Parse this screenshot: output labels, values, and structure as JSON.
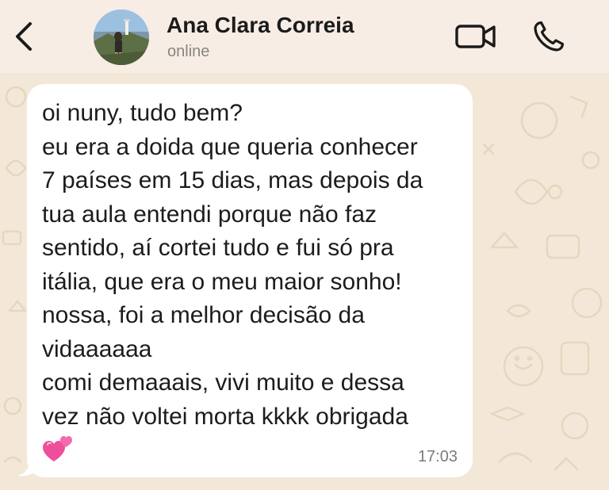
{
  "header": {
    "back_icon": "chevron-left-icon",
    "contact_name": "Ana Clara Correia",
    "contact_status": "online",
    "video_call_icon": "video-camera-icon",
    "voice_call_icon": "phone-icon"
  },
  "message": {
    "lines": [
      "oi nuny, tudo bem?",
      "eu era a doida que queria conhecer",
      "7 países em 15 dias, mas depois da",
      "tua aula entendi porque não faz",
      "sentido, aí cortei tudo e fui só pra",
      "itália, que era o meu maior sonho!",
      "nossa, foi a melhor decisão da",
      "vidaaaaaa",
      "comi demaaais, vivi muito e dessa",
      "vez não voltei morta kkkk obrigada"
    ],
    "emoji": "two-hearts-emoji",
    "time": "17:03"
  },
  "colors": {
    "header_bg": "#f7ede4",
    "chat_bg": "#f3e8d8",
    "bubble_bg": "#ffffff",
    "text": "#1c1c1c",
    "status_gray": "#8a8580",
    "heart_pink": "#ee4f9a"
  }
}
